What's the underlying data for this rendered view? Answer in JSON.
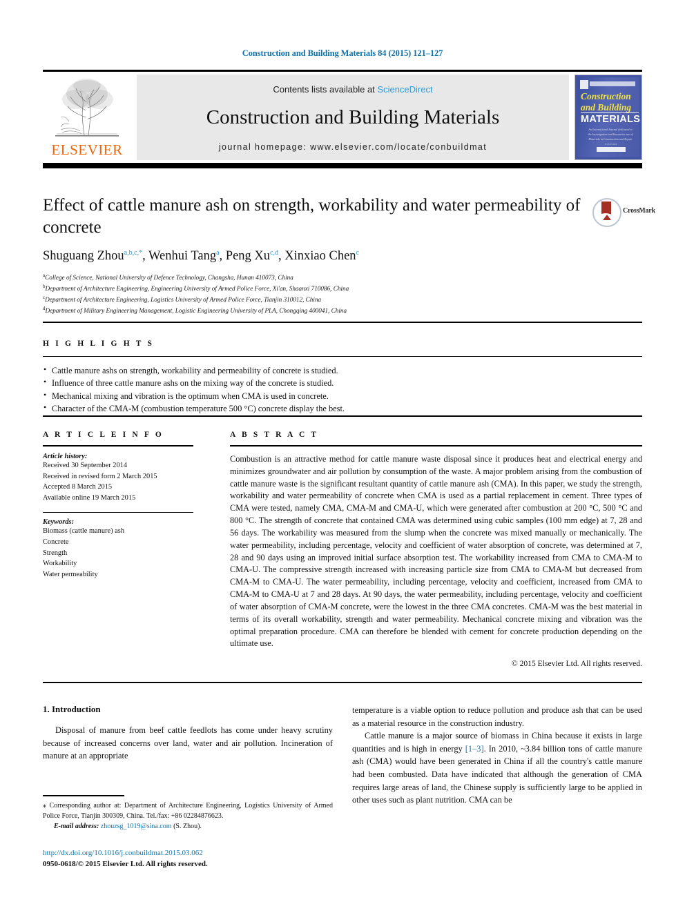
{
  "running_head": "Construction and Building Materials 84 (2015) 121–127",
  "masthead": {
    "contents_prefix": "Contents lists available at ",
    "sciencedirect": "ScienceDirect",
    "journal_title": "Construction and Building Materials",
    "homepage": "journal homepage: www.elsevier.com/locate/conbuildmat",
    "publisher_logo_text": "ELSEVIER",
    "cover": {
      "line1": "Construction",
      "line2": "and Building",
      "line3": "MATERIALS",
      "blurb": "An International Journal dedicated to the Investigation and Innovative use of Materials in Construction and Repair",
      "footer": "ELSEVIER"
    }
  },
  "crossmark": {
    "label": "CrossMark"
  },
  "article": {
    "title": "Effect of cattle manure ash on strength, workability and water permeability of concrete",
    "authors": [
      {
        "name": "Shuguang Zhou",
        "marks": "a,b,c,",
        "star": "*"
      },
      {
        "name": "Wenhui Tang",
        "marks": "a",
        "star": ""
      },
      {
        "name": "Peng Xu",
        "marks": "c,d",
        "star": ""
      },
      {
        "name": "Xinxiao Chen",
        "marks": "c",
        "star": ""
      }
    ],
    "affiliations": [
      {
        "mark": "a",
        "text": "College of Science, National University of Defence Technology, Changsha, Hunan 410073, China"
      },
      {
        "mark": "b",
        "text": "Department of Architecture Engineering, Engineering University of Armed Police Force, Xi'an, Shaanxi 710086, China"
      },
      {
        "mark": "c",
        "text": "Department of Architecture Engineering, Logistics University of Armed Police Force, Tianjin 310012, China"
      },
      {
        "mark": "d",
        "text": "Department of Military Engineering Management, Logistic Engineering University of PLA, Chongqing 400041, China"
      }
    ]
  },
  "highlights": {
    "label": "H I G H L I G H T S",
    "items": [
      "Cattle manure ashs on strength, workability and permeability of concrete is studied.",
      "Influence of three cattle manure ashs on the mixing way of the concrete is studied.",
      "Mechanical mixing and vibration is the optimum when CMA is used in concrete.",
      "Character of the CMA-M (combustion temperature 500 °C) concrete display the best."
    ]
  },
  "article_info": {
    "label": "A R T I C L E   I N F O",
    "history_label": "Article history:",
    "history": [
      "Received 30 September 2014",
      "Received in revised form 2 March 2015",
      "Accepted 8 March 2015",
      "Available online 19 March 2015"
    ],
    "keywords_label": "Keywords:",
    "keywords": [
      "Biomass (cattle manure) ash",
      "Concrete",
      "Strength",
      "Workability",
      "Water permeability"
    ]
  },
  "abstract": {
    "label": "A B S T R A C T",
    "text": "Combustion is an attractive method for cattle manure waste disposal since it produces heat and electrical energy and minimizes groundwater and air pollution by consumption of the waste. A major problem arising from the combustion of cattle manure waste is the significant resultant quantity of cattle manure ash (CMA). In this paper, we study the strength, workability and water permeability of concrete when CMA is used as a partial replacement in cement. Three types of CMA were tested, namely CMA, CMA-M and CMA-U, which were generated after combustion at 200 °C, 500 °C and 800 °C. The strength of concrete that contained CMA was determined using cubic samples (100 mm edge) at 7, 28 and 56 days. The workability was measured from the slump when the concrete was mixed manually or mechanically. The water permeability, including percentage, velocity and coefficient of water absorption of concrete, was determined at 7, 28 and 90 days using an improved initial surface absorption test. The workability increased from CMA to CMA-M to CMA-U. The compressive strength increased with increasing particle size from CMA to CMA-M but decreased from CMA-M to CMA-U. The water permeability, including percentage, velocity and coefficient, increased from CMA to CMA-M to CMA-U at 7 and 28 days. At 90 days, the water permeability, including percentage, velocity and coefficient of water absorption of CMA-M concrete, were the lowest in the three CMA concretes. CMA-M was the best material in terms of its overall workability, strength and water permeability. Mechanical concrete mixing and vibration was the optimal preparation procedure. CMA can therefore be blended with cement for concrete production depending on the ultimate use.",
    "copyright": "© 2015 Elsevier Ltd. All rights reserved."
  },
  "body": {
    "section_title": "1. Introduction",
    "left_paragraph": "Disposal of manure from beef cattle feedlots has come under heavy scrutiny because of increased concerns over land, water and air pollution. Incineration of manure at an appropriate",
    "right_paragraph_1": "temperature is a viable option to reduce pollution and produce ash that can be used as a material resource in the construction industry.",
    "right_paragraph_2_pre": "Cattle manure is a major source of biomass in China because it exists in large quantities and is high in energy ",
    "right_paragraph_2_ref": "[1–3]",
    "right_paragraph_2_post": ". In 2010, ~3.84 billion tons of cattle manure ash (CMA) would have been generated in China if all the country's cattle manure had been combusted. Data have indicated that although the generation of CMA requires large areas of land, the Chinese supply is sufficiently large to be applied in other uses such as plant nutrition. CMA can be"
  },
  "footnote": {
    "corresponding": "⁎ Corresponding author at: Department of Architecture Engineering, Logistics University of Armed Police Force, Tianjin 300309, China. Tel./fax: +86 02284876623.",
    "email_label": "E-mail address:",
    "email": "zhouzsg_1019@sina.com",
    "email_suffix": "(S. Zhou).",
    "doi": "http://dx.doi.org/10.1016/j.conbuildmat.2015.03.062",
    "issn": "0950-0618/© 2015 Elsevier Ltd. All rights reserved."
  },
  "colors": {
    "link_blue": "#1273a8",
    "sciencedirect_blue": "#2e9bd6",
    "elsevier_orange": "#ec6608",
    "cover_blue": "#4255a5",
    "cover_yellow": "#f2e23c",
    "crossmark_red": "#a62f23"
  }
}
